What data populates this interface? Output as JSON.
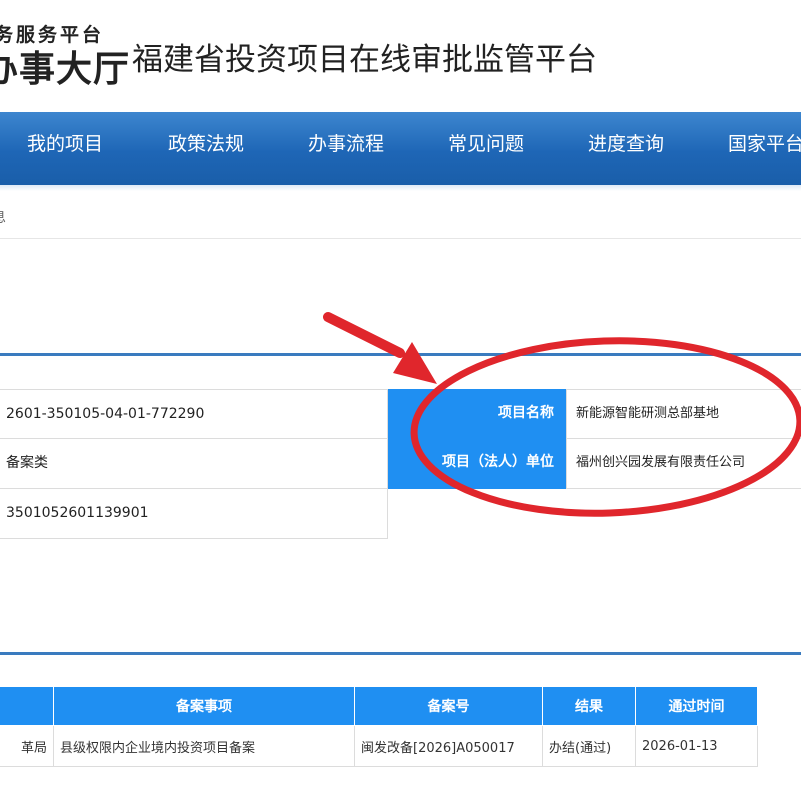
{
  "header": {
    "logo_small": "务服务平台",
    "logo_big": "办事大厅",
    "title": "福建省投资项目在线审批监管平台"
  },
  "nav": [
    "我的项目",
    "政策法规",
    "办事流程",
    "常见问题",
    "进度查询",
    "国家平台"
  ],
  "breadcrumb": "息",
  "project_info": {
    "code": "2601-350105-04-01-772290",
    "type": "备案类",
    "record_no": "3501052601139901",
    "name_label": "项目名称",
    "name_value": "新能源智能研测总部基地",
    "unit_label": "项目（法人）单位",
    "unit_value": "福州创兴园发展有限责任公司"
  },
  "record_table": {
    "headers": [
      "",
      "备案事项",
      "备案号",
      "结果",
      "通过时间"
    ],
    "rows": [
      [
        "革局",
        "县级权限内企业境内投资项目备案",
        "闽发改备[2026]A050017",
        "办结(通过)",
        "2026-01-13"
      ]
    ]
  },
  "annotation": {
    "color": "#e0262c",
    "arrow": "red-arrow",
    "highlight": "red-ellipse"
  }
}
